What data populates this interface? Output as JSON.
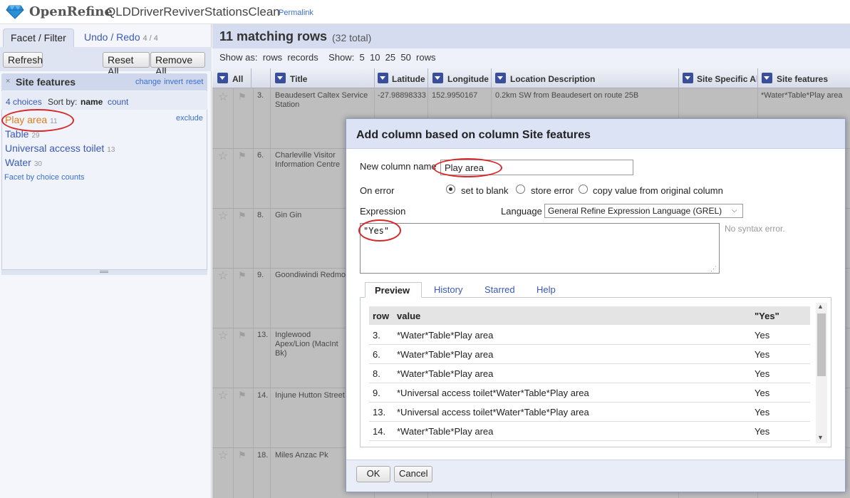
{
  "header": {
    "app_name": "OpenRefine",
    "project_name": "QLDDriverReviverStationsClean",
    "permalink": "Permalink"
  },
  "left_panel": {
    "tab_facet": "Facet / Filter",
    "tab_undo": "Undo / Redo",
    "tab_undo_count": "4 / 4",
    "refresh": "Refresh",
    "reset_all": "Reset All",
    "remove_all": "Remove All",
    "facet": {
      "close_icon": "×",
      "title": "Site features",
      "change": "change",
      "invert": "invert",
      "reset": "reset",
      "choices_count": "4 choices",
      "sort_by": "Sort by:",
      "sort_name": "name",
      "sort_count": "count",
      "exclude": "exclude",
      "choices": [
        {
          "label": "Play area",
          "count": "11"
        },
        {
          "label": "Table",
          "count": "29"
        },
        {
          "label": "Universal access toilet",
          "count": "13"
        },
        {
          "label": "Water",
          "count": "30"
        }
      ],
      "facet_by_counts": "Facet by choice counts"
    }
  },
  "grid": {
    "matching": "11 matching rows",
    "total": "(32 total)",
    "view_text": "Show as:  rows  records    Show:  5  10  25  50  rows",
    "columns": [
      "All",
      "Title",
      "Latitude",
      "Longitude",
      "Location Description",
      "Site Specific Ale",
      "Site features"
    ],
    "rows": [
      {
        "num": "3.",
        "title": "Beaudesert Caltex Service Station",
        "lat": "-27.98898333",
        "lon": "152.9950167",
        "loc": "0.2km SW from Beaudesert on route 25B",
        "features": "*Water*Table*Play area"
      },
      {
        "num": "6.",
        "title": "Charleville Visitor Information Centre"
      },
      {
        "num": "8.",
        "title": "Gin Gin"
      },
      {
        "num": "9.",
        "title": "Goondiwindi Redmon"
      },
      {
        "num": "13.",
        "title": "Inglewood Apex/Lion (MacInt Bk)"
      },
      {
        "num": "14.",
        "title": "Injune Hutton Street"
      },
      {
        "num": "18.",
        "title": "Miles Anzac Pk"
      }
    ]
  },
  "dialog": {
    "title": "Add column based on column Site features",
    "new_column_label": "New column name",
    "new_column_value": "Play area",
    "on_error_label": "On error",
    "on_error_options": [
      "set to blank",
      "store error",
      "copy value from original column"
    ],
    "expression_label": "Expression",
    "language_label": "Language",
    "language_value": "General Refine Expression Language (GREL)",
    "expression": "\"Yes\"",
    "syntax_msg": "No syntax error.",
    "tabs": [
      "Preview",
      "History",
      "Starred",
      "Help"
    ],
    "preview": {
      "headers": [
        "row",
        "value",
        "\"Yes\""
      ],
      "rows": [
        {
          "row": "3.",
          "value": "*Water*Table*Play area",
          "result": "Yes"
        },
        {
          "row": "6.",
          "value": "*Water*Table*Play area",
          "result": "Yes"
        },
        {
          "row": "8.",
          "value": "*Water*Table*Play area",
          "result": "Yes"
        },
        {
          "row": "9.",
          "value": "*Universal access toilet*Water*Table*Play area",
          "result": "Yes"
        },
        {
          "row": "13.",
          "value": "*Universal access toilet*Water*Table*Play area",
          "result": "Yes"
        },
        {
          "row": "14.",
          "value": "*Water*Table*Play area",
          "result": "Yes"
        }
      ]
    },
    "ok": "OK",
    "cancel": "Cancel"
  },
  "colors": {
    "accent": "#3a59b8",
    "highlight_ring": "#d8282a",
    "selected_choice": "#e07d1a"
  }
}
